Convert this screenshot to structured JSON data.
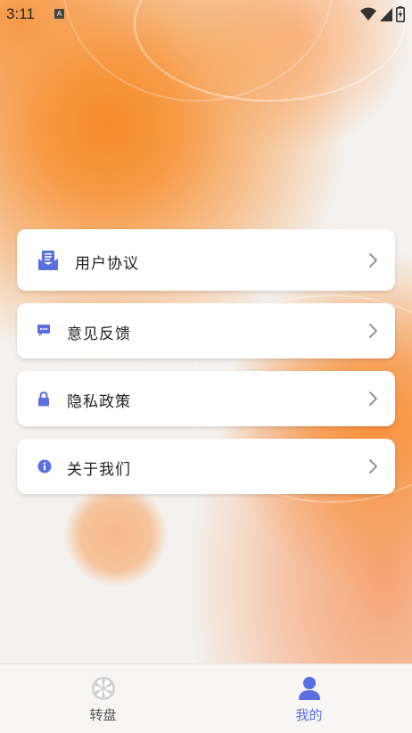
{
  "status_bar": {
    "time": "3:11",
    "notification_badge": "A",
    "icons": [
      "wifi-icon",
      "signal-icon",
      "battery-charging-icon"
    ]
  },
  "menu": {
    "items": [
      {
        "label": "用户协议",
        "icon": "mail-icon"
      },
      {
        "label": "意见反馈",
        "icon": "chat-icon"
      },
      {
        "label": "隐私政策",
        "icon": "lock-icon"
      },
      {
        "label": "关于我们",
        "icon": "info-icon"
      }
    ]
  },
  "bottom_nav": {
    "items": [
      {
        "label": "转盘",
        "icon": "wheel-icon",
        "active": false
      },
      {
        "label": "我的",
        "icon": "user-icon",
        "active": true
      }
    ]
  },
  "colors": {
    "accent": "#5b6fe0",
    "inactive": "#555555",
    "icon_inactive": "#cccccc",
    "orange": "#f58a2a"
  }
}
